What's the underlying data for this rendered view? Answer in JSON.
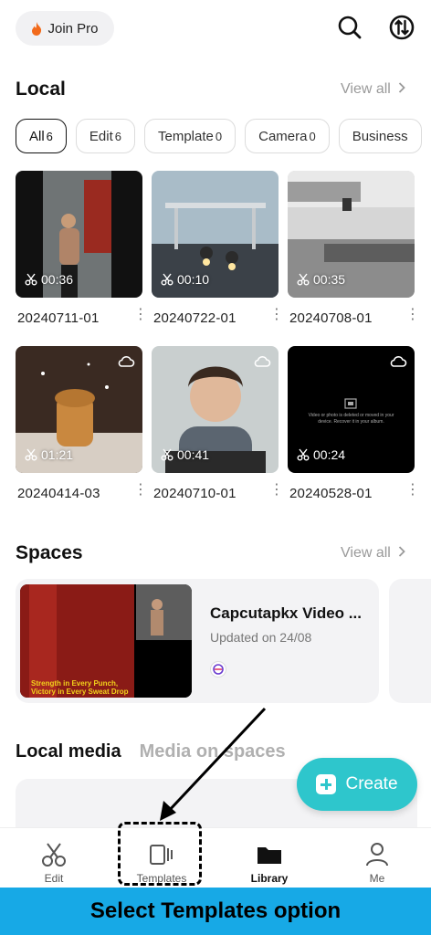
{
  "header": {
    "join_pro_label": "Join Pro",
    "icons": [
      "search-icon",
      "export-import-icon"
    ]
  },
  "local": {
    "title": "Local",
    "view_all": "View all",
    "chips": [
      {
        "label": "All",
        "count": "6",
        "active": true
      },
      {
        "label": "Edit",
        "count": "6"
      },
      {
        "label": "Template",
        "count": "0"
      },
      {
        "label": "Camera",
        "count": "0"
      },
      {
        "label": "Business",
        "count": ""
      }
    ],
    "items": [
      {
        "name": "20240711-01",
        "duration": "00:36",
        "cloud": false
      },
      {
        "name": "20240722-01",
        "duration": "00:10",
        "cloud": false
      },
      {
        "name": "20240708-01",
        "duration": "00:35",
        "cloud": false
      },
      {
        "name": "20240414-03",
        "duration": "01:21",
        "cloud": true
      },
      {
        "name": "20240710-01",
        "duration": "00:41",
        "cloud": true
      },
      {
        "name": "20240528-01",
        "duration": "00:24",
        "cloud": true
      }
    ],
    "missing_notice": "Video or photo is deleted or moved in your device. Recover it in your album."
  },
  "spaces": {
    "title": "Spaces",
    "view_all": "View all",
    "card": {
      "name": "Capcutapkx Video ...",
      "updated": "Updated on 24/08",
      "thumb_caption_line1": "Strength in Every Punch,",
      "thumb_caption_line2": "Victory in Every Sweat Drop"
    }
  },
  "media_tabs": {
    "local_media": "Local media",
    "media_on_spaces": "Media on spaces"
  },
  "create_button": "Create",
  "bottom_nav": [
    {
      "label": "Edit",
      "icon": "scissors-icon"
    },
    {
      "label": "Templates",
      "icon": "templates-icon"
    },
    {
      "label": "Library",
      "icon": "folder-icon",
      "active": true
    },
    {
      "label": "Me",
      "icon": "person-icon"
    }
  ],
  "instruction_caption": "Select Templates option",
  "colors": {
    "accent": "#2ec6cc",
    "caption_bg": "#17a9e6"
  }
}
